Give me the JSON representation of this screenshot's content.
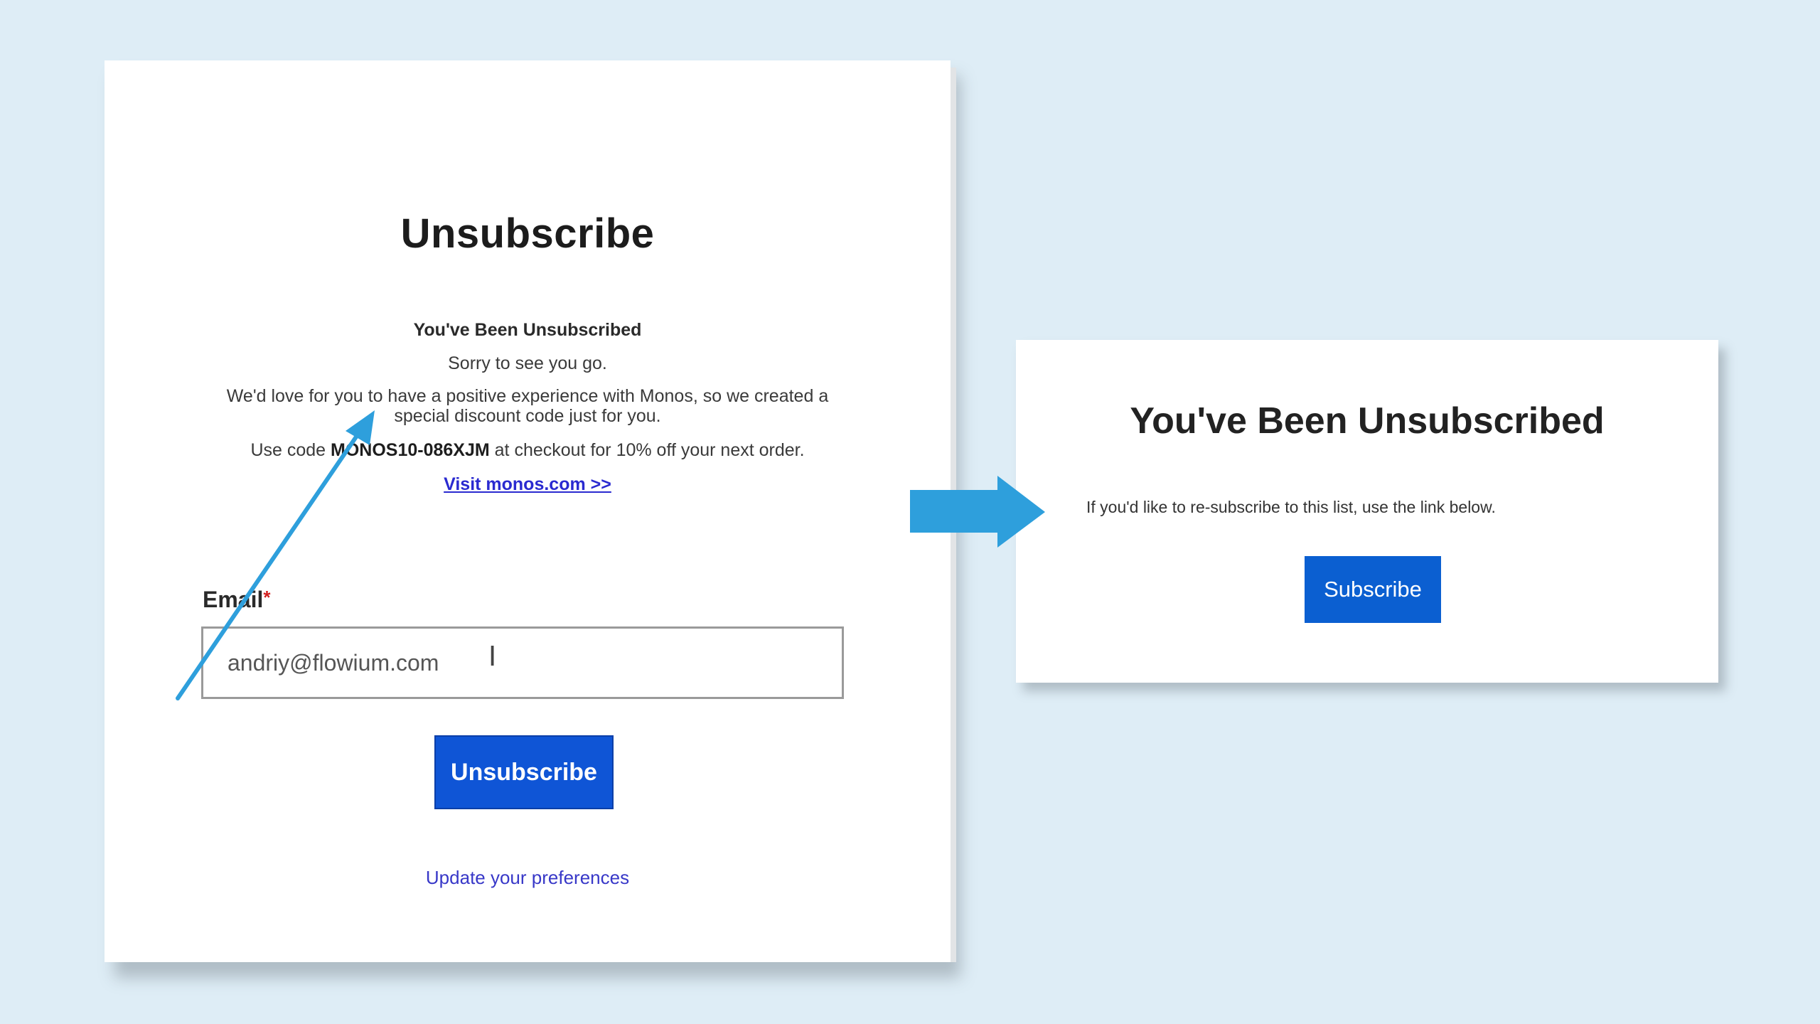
{
  "left_card": {
    "title": "Unsubscribe",
    "message_heading": "You've Been Unsubscribed",
    "sorry_text": "Sorry to see you go.",
    "love_text": "We'd love for you to have a positive experience with Monos, so we created a special discount code just for you.",
    "code_prefix": "Use code ",
    "code": "MONOS10-086XJM",
    "code_suffix": " at checkout for 10% off your next order.",
    "visit_link": "Visit monos.com >>",
    "email_label": "Email",
    "email_required_mark": "*",
    "email_value": "andriy@flowium.com",
    "unsubscribe_button": "Unsubscribe",
    "preferences_link": "Update your preferences"
  },
  "right_card": {
    "title": "You've Been Unsubscribed",
    "resubscribe_text": "If you'd like to re-subscribe to this list, use the link below.",
    "subscribe_button": "Subscribe"
  },
  "colors": {
    "background": "#deedf6",
    "arrow": "#2e9fdc",
    "button_primary": "#0f55d6",
    "link": "#2a2ad0"
  },
  "icons": {
    "text_cursor": "text-cursor-icon",
    "pointer_arrow": "diagonal-arrow-icon",
    "transition_arrow": "right-arrow-icon"
  }
}
